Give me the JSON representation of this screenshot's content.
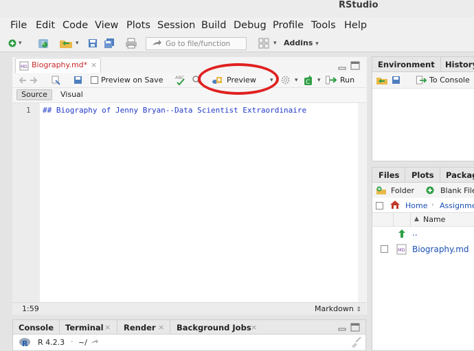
{
  "window": {
    "title": "RStudio"
  },
  "menu": [
    "File",
    "Edit",
    "Code",
    "View",
    "Plots",
    "Session",
    "Build",
    "Debug",
    "Profile",
    "Tools",
    "Help"
  ],
  "main_toolbar": {
    "goto_placeholder": "Go to file/function",
    "addins_label": "Addins"
  },
  "editor": {
    "tab_label": "Biography.md*",
    "tab_close": "×",
    "preview_on_save_label": "Preview on Save",
    "preview_on_save_checked": false,
    "preview_label": "Preview",
    "run_label": "Run",
    "source_label": "Source",
    "visual_label": "Visual",
    "line_numbers": [
      "1"
    ],
    "lines": [
      "## Biography of Jenny Bryan--Data Scientist Extraordinaire"
    ],
    "cursor_pos": "1:59",
    "mode": "Markdown"
  },
  "env_pane": {
    "tabs": [
      "Environment",
      "History"
    ],
    "to_console_label": "To Console"
  },
  "files_pane": {
    "tabs": [
      "Files",
      "Plots",
      "Packag"
    ],
    "folder_label": "Folder",
    "blank_file_label": "Blank File",
    "breadcrumb": [
      "Home",
      "Assignme"
    ],
    "column_name": "Name",
    "parent_dir": "..",
    "items": [
      {
        "name": "Biography.md"
      }
    ]
  },
  "console_pane": {
    "tabs": [
      "Console",
      "Terminal",
      "Render",
      "Background Jobs"
    ],
    "version": "R 4.2.3",
    "path": "~/"
  },
  "colors": {
    "accent_red": "#e02020",
    "modified_tab": "#c62828",
    "code_blue": "#2038c8",
    "link_blue": "#1a4fb4"
  }
}
